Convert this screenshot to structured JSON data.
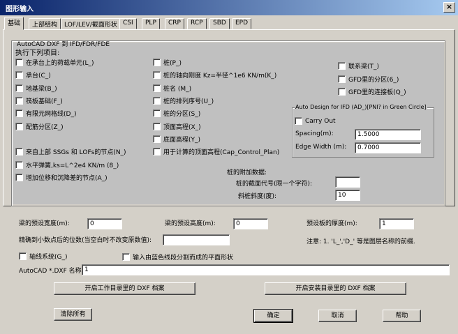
{
  "window": {
    "title": "图形输入",
    "close": "×"
  },
  "tabs": [
    "基础",
    "上部结构",
    "LOF/LEV/截面形状",
    "CSI",
    "PLP",
    "CRP",
    "RCP",
    "SBD",
    "EPD"
  ],
  "group": {
    "title": "AutoCAD DXF 到 IFD/FDR/FDE",
    "subtitle": "执行下列项目:",
    "col1": [
      "在承台上的荷载单元(L_)",
      "承台(C_)",
      "地基梁(B_)",
      "筏板基础(F_)",
      "有限元网格线(D_)",
      "配筋分区(Z_)",
      "来自上部 SSGs 和 LOFs的节点(N_)",
      "水平弹簧,ks=L^2e4 KN/m (8_)",
      "增加位移和沉降差的节点(A_)"
    ],
    "col2": [
      "桩(P_)",
      "桩的轴向刚度 Kz=半径^1e6 KN/m(K_)",
      "桩名 (M_)",
      "桩的排列序号(U_)",
      "桩的分区(S_)",
      "顶面高程(X_)",
      "底面高程(Y_)",
      "用于计算的顶面高程(Cap_Control_Plan)"
    ],
    "col3": [
      "联系梁(T_)",
      "GFD里的分区(6_)",
      "GFD里的连接板(Q_)"
    ],
    "ifd": {
      "title": "Auto Design for IFD (AD_)[PNI? in Green Circle]",
      "carry_out": "Carry Out",
      "spacing_label": "Spacing(m):",
      "spacing_value": "1.5000",
      "edge_label": "Edge Width (m):",
      "edge_value": "0.7000"
    },
    "pile_extra": {
      "title": "桩的附加数据:",
      "section_label": "桩的截面代号(限一个字符):",
      "section_value": "",
      "slope_label": "斜桩斜度(度):",
      "slope_value": "10"
    }
  },
  "lower": {
    "beam_width_label": "梁的预设宽度(m):",
    "beam_width_value": "0",
    "beam_height_label": "梁的预设高度(m):",
    "beam_height_value": "0",
    "slab_thick_label": "预设板的厚度(m):",
    "slab_thick_value": "1",
    "precision_label": "精确到小数点后的位数(当空白时不改变原数值):",
    "precision_value": "",
    "note": "注意: 1. 'L_','D_' 等是图层名称的前缀.",
    "axis_system": "轴线系统(G_)",
    "blue_line": "输入由蓝色线段分割而成的平面形状",
    "dxf_name_label": "AutoCAD *.DXF 名称:",
    "dxf_name_value": "1"
  },
  "buttons": {
    "open_work_dir": "开启工作目录里的 DXF 档案",
    "open_install_dir": "开启安装目录里的 DXF 档案",
    "clear_all": "清除所有",
    "ok": "确定",
    "cancel": "取消",
    "help": "帮助"
  }
}
